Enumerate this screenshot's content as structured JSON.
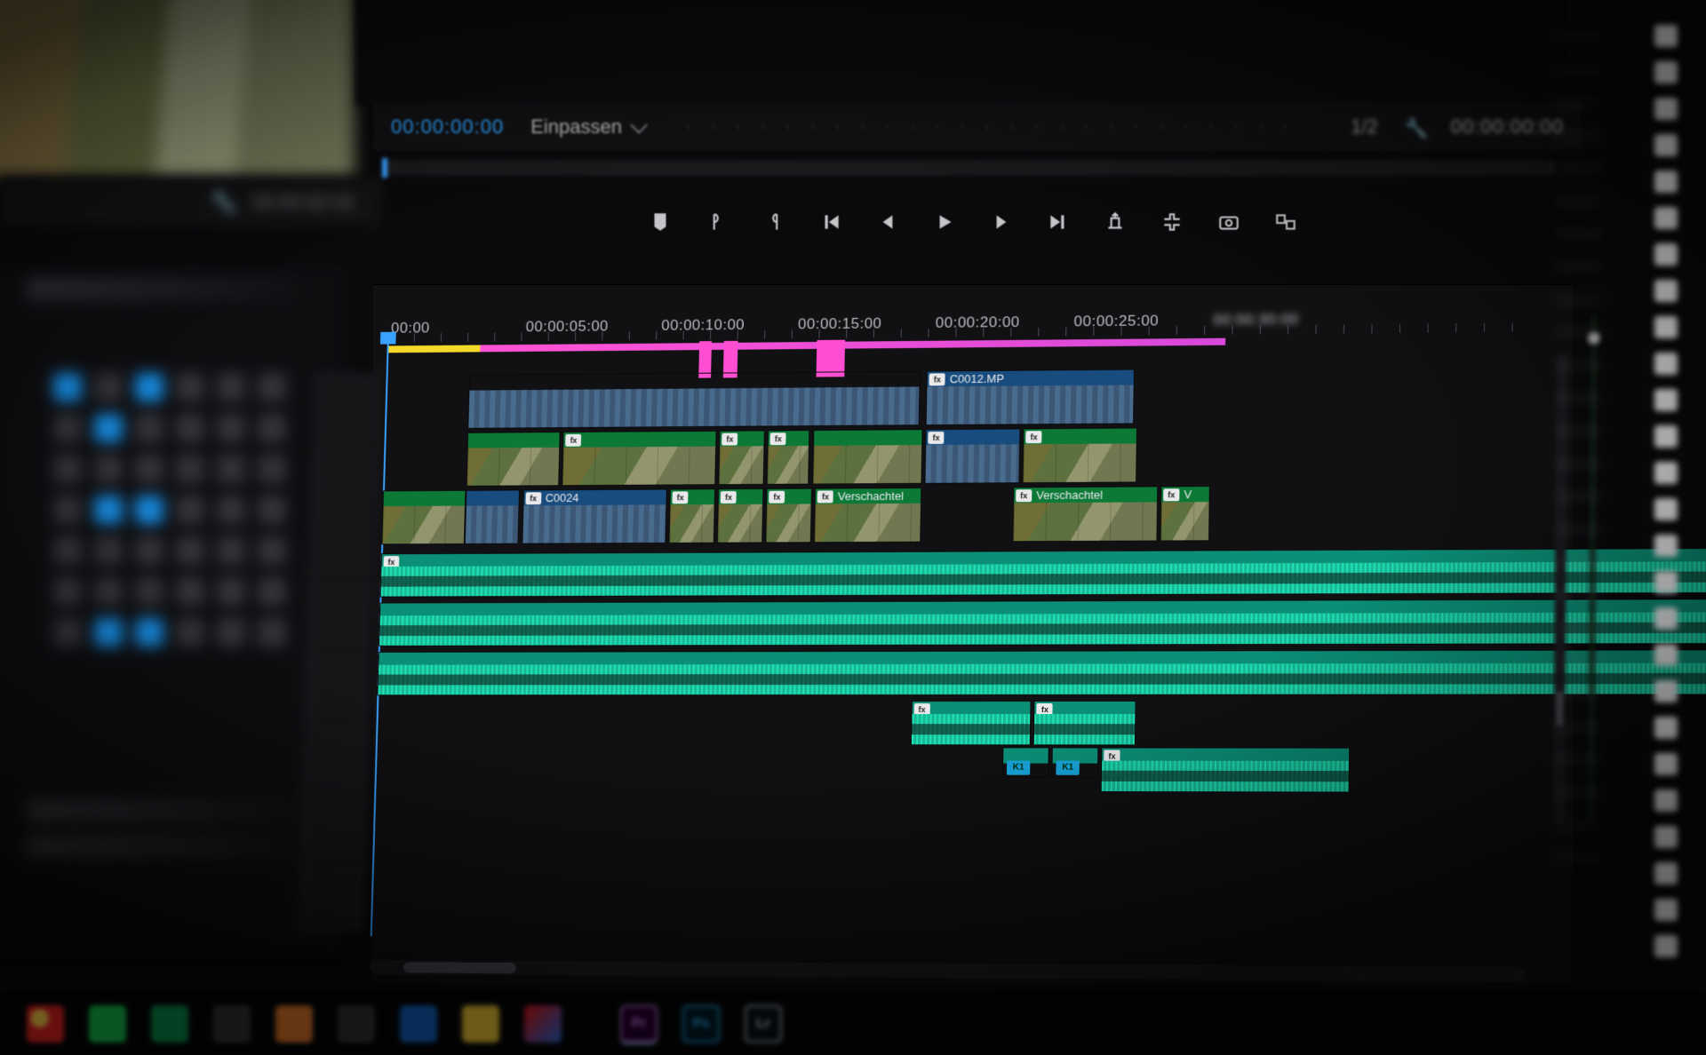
{
  "source_monitor": {
    "timecode": "00:00:02:01"
  },
  "program_monitor": {
    "timecode": "00:00:00:00",
    "fit_label": "Einpassen",
    "fraction": "1/2",
    "duration": "00:00:00:00"
  },
  "transport": {
    "buttons": [
      "marker-in-icon",
      "mark-in-icon",
      "mark-out-icon",
      "go-to-in-icon",
      "step-back-icon",
      "play-icon",
      "step-fwd-icon",
      "go-to-out-icon",
      "lift-icon",
      "extract-icon",
      "export-frame-icon",
      "toggle-multicam-icon"
    ]
  },
  "timeline": {
    "ruler": [
      "00:00",
      "00:00:05:00",
      "00:00:10:00",
      "00:00:15:00",
      "00:00:20:00",
      "00:00:25:00",
      "00:00:30:00"
    ],
    "tracks": {
      "V3": [
        {
          "start": 56,
          "len": 300,
          "kind": "nest",
          "label": ""
        },
        {
          "start": 360,
          "len": 136,
          "kind": "nest",
          "bar": "tg-dblue",
          "fx": true,
          "label": "C0012.MP"
        }
      ],
      "V2": [
        {
          "start": 56,
          "len": 62,
          "kind": "thumb",
          "bar": "tg-dgrn"
        },
        {
          "start": 120,
          "len": 102,
          "kind": "thumb",
          "bar": "tg-dgrn",
          "fx": true
        },
        {
          "start": 224,
          "len": 30,
          "kind": "thumb",
          "bar": "tg-dgrn",
          "fx": true
        },
        {
          "start": 256,
          "len": 28,
          "kind": "thumb",
          "bar": "tg-dgrn",
          "fx": true
        },
        {
          "start": 286,
          "len": 72,
          "kind": "thumb",
          "bar": "tg-dgrn"
        },
        {
          "start": 360,
          "len": 62,
          "kind": "nest",
          "bar": "tg-dblue",
          "fx": true
        },
        {
          "start": 424,
          "len": 74,
          "kind": "thumb",
          "bar": "tg-dgrn",
          "fx": true
        }
      ],
      "V1": [
        {
          "start": 0,
          "len": 56,
          "kind": "thumb",
          "bar": "tg-dgrn"
        },
        {
          "start": 56,
          "len": 36,
          "kind": "nest",
          "bar": "tg-dblue"
        },
        {
          "start": 94,
          "len": 96,
          "kind": "nest",
          "bar": "tg-dblue",
          "fx": true,
          "label": "C0024"
        },
        {
          "start": 192,
          "len": 30,
          "kind": "thumb",
          "bar": "tg-dgrn",
          "fx": true
        },
        {
          "start": 224,
          "len": 30,
          "kind": "thumb",
          "bar": "tg-dgrn",
          "fx": true
        },
        {
          "start": 256,
          "len": 30,
          "kind": "thumb",
          "bar": "tg-dgrn",
          "fx": true
        },
        {
          "start": 288,
          "len": 70,
          "kind": "thumb",
          "bar": "tg-dgrn",
          "fx": true,
          "label": "Verschachtel"
        },
        {
          "start": 418,
          "len": 94,
          "kind": "thumb",
          "bar": "tg-dgrn",
          "fx": true,
          "label": "Verschachtel"
        },
        {
          "start": 514,
          "len": 32,
          "kind": "thumb",
          "bar": "tg-dgrn",
          "fx": true,
          "label": "V"
        }
      ],
      "A1": [
        {
          "start": 0,
          "len": 954,
          "kind": "aud",
          "bar": "tg-teal",
          "fx": true
        }
      ],
      "A2": [
        {
          "start": 0,
          "len": 954,
          "kind": "aud",
          "bar": "tg-teal"
        }
      ],
      "A3": [
        {
          "start": 0,
          "len": 954,
          "kind": "aud",
          "bar": "tg-teal"
        }
      ],
      "A4": [
        {
          "start": 354,
          "len": 78,
          "kind": "aud",
          "bar": "tg-teal",
          "fx": true
        },
        {
          "start": 434,
          "len": 66,
          "kind": "aud",
          "bar": "tg-teal",
          "fx": true
        }
      ],
      "A5": [
        {
          "start": 414,
          "len": 30,
          "kind": "aud-sm",
          "bar": "tg-teal",
          "k": "K1"
        },
        {
          "start": 446,
          "len": 30,
          "kind": "aud-sm",
          "bar": "tg-teal",
          "k": "K1"
        },
        {
          "start": 478,
          "len": 160,
          "kind": "aud",
          "bar": "tg-teal",
          "fx": true
        }
      ]
    },
    "track_top": {
      "V3": 96,
      "V2": 162,
      "V1": 228,
      "A1": 300,
      "A2": 356,
      "A3": 412,
      "A4": 468,
      "A5": 520
    }
  },
  "taskbar": {
    "apps": [
      "chrome",
      "whatsapp",
      "spotify",
      "steam",
      "vlc-icon",
      "stack",
      "blue",
      "folder",
      "creative-cloud",
      "gap",
      "premiere",
      "photoshop",
      "lightroom"
    ],
    "labels": {
      "premiere": "Pr",
      "photoshop": "Ps",
      "lightroom": "Lr"
    }
  },
  "right_check_count": 26
}
